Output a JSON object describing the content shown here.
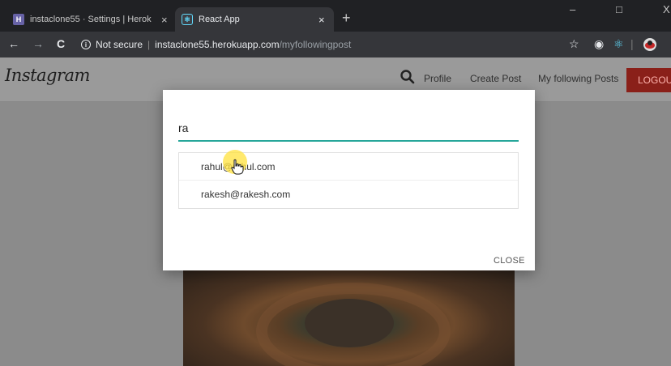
{
  "browser": {
    "tabs": [
      {
        "title": "instaclone55 · Settings | Heroku",
        "close": "×"
      },
      {
        "title": "React App",
        "close": "×"
      }
    ],
    "new_tab": "+",
    "nav": {
      "back": "←",
      "forward": "→",
      "reload": "C"
    },
    "address": {
      "security": "Not secure",
      "separator": "|",
      "host": "instaclone55.herokuapp.com",
      "path": "/myfollowingpost"
    },
    "window_controls": {
      "minimize": "–",
      "maximize": "□",
      "close": "X"
    }
  },
  "navbar": {
    "brand": "Instagram",
    "links": {
      "profile": "Profile",
      "create_post": "Create Post",
      "following": "My following Posts"
    },
    "logout": "LOGOU"
  },
  "modal": {
    "search_value": "ra",
    "results": [
      "rahul@rahul.com",
      "rakesh@rakesh.com"
    ],
    "close_label": "CLOSE"
  },
  "colors": {
    "accent_underline": "#26a69a",
    "logout_red": "#8a2019"
  }
}
